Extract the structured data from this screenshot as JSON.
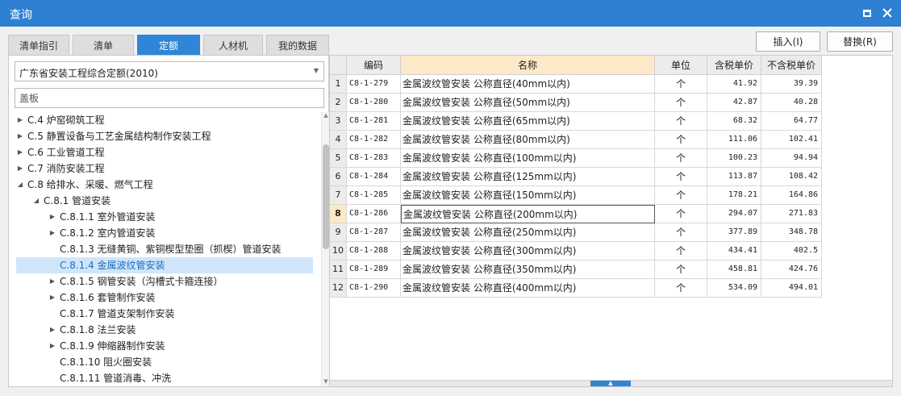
{
  "window": {
    "title": "查询"
  },
  "tabs": [
    "清单指引",
    "清单",
    "定额",
    "人材机",
    "我的数据"
  ],
  "active_tab": "定额",
  "left": {
    "dropdown_value": "广东省安装工程综合定额(2010)",
    "search_value": "盖板",
    "tree": [
      {
        "label": "C.4 炉窑砌筑工程",
        "toggle": "▶"
      },
      {
        "label": "C.5 静置设备与工艺金属结构制作安装工程",
        "toggle": "▶"
      },
      {
        "label": "C.6 工业管道工程",
        "toggle": "▶"
      },
      {
        "label": "C.7 消防安装工程",
        "toggle": "▶"
      },
      {
        "label": "C.8 给排水、采暖、燃气工程",
        "toggle": "◢"
      },
      {
        "label": "C.8.1 管道安装",
        "toggle": "◢"
      },
      {
        "label": "C.8.1.1 室外管道安装",
        "toggle": "▶"
      },
      {
        "label": "C.8.1.2 室内管道安装",
        "toggle": "▶"
      },
      {
        "label": "C.8.1.3 无缝黄铜、紫铜楔型垫圈（抓楔）管道安装",
        "toggle": ""
      },
      {
        "label": "C.8.1.4 金属波纹管安装",
        "toggle": ""
      },
      {
        "label": "C.8.1.5 钢管安装（沟槽式卡箍连接）",
        "toggle": "▶"
      },
      {
        "label": "C.8.1.6 套管制作安装",
        "toggle": "▶"
      },
      {
        "label": "C.8.1.7 管道支架制作安装",
        "toggle": ""
      },
      {
        "label": "C.8.1.8 法兰安装",
        "toggle": "▶"
      },
      {
        "label": "C.8.1.9 伸缩器制作安装",
        "toggle": "▶"
      },
      {
        "label": "C.8.1.10 阻火圈安装",
        "toggle": ""
      },
      {
        "label": "C.8.1.11 管道消毒、冲洗",
        "toggle": ""
      }
    ],
    "selected_item": "C.8.1.4 金属波纹管安装"
  },
  "toolbar": {
    "insert_label": "插入(I)",
    "replace_label": "替换(R)"
  },
  "table": {
    "headers": [
      "编码",
      "名称",
      "单位",
      "含税单价",
      "不含税单价"
    ],
    "current_row": "8",
    "rows": [
      [
        "1",
        "C8-1-279",
        "金属波纹管安装 公称直径(40mm以内)",
        "个",
        "41.92",
        "39.39"
      ],
      [
        "2",
        "C8-1-280",
        "金属波纹管安装 公称直径(50mm以内)",
        "个",
        "42.87",
        "40.28"
      ],
      [
        "3",
        "C8-1-281",
        "金属波纹管安装 公称直径(65mm以内)",
        "个",
        "68.32",
        "64.77"
      ],
      [
        "4",
        "C8-1-282",
        "金属波纹管安装 公称直径(80mm以内)",
        "个",
        "111.06",
        "102.41"
      ],
      [
        "5",
        "C8-1-283",
        "金属波纹管安装 公称直径(100mm以内)",
        "个",
        "100.23",
        "94.94"
      ],
      [
        "6",
        "C8-1-284",
        "金属波纹管安装 公称直径(125mm以内)",
        "个",
        "113.87",
        "108.42"
      ],
      [
        "7",
        "C8-1-285",
        "金属波纹管安装 公称直径(150mm以内)",
        "个",
        "178.21",
        "164.86"
      ],
      [
        "8",
        "C8-1-286",
        "金属波纹管安装 公称直径(200mm以内)",
        "个",
        "294.07",
        "271.83"
      ],
      [
        "9",
        "C8-1-287",
        "金属波纹管安装 公称直径(250mm以内)",
        "个",
        "377.89",
        "348.78"
      ],
      [
        "10",
        "C8-1-288",
        "金属波纹管安装 公称直径(300mm以内)",
        "个",
        "434.41",
        "402.5"
      ],
      [
        "11",
        "C8-1-289",
        "金属波纹管安装 公称直径(350mm以内)",
        "个",
        "458.81",
        "424.76"
      ],
      [
        "12",
        "C8-1-290",
        "金属波纹管安装 公称直径(400mm以内)",
        "个",
        "534.09",
        "494.01"
      ]
    ]
  },
  "icons": {
    "maximize": "maximize-icon",
    "close": "close-icon",
    "dropdown": "chevron-down-icon",
    "scroll_up": "scroll-up-icon",
    "scroll_down": "scroll-down-icon",
    "grip": "splitter-grip-icon"
  },
  "colors": {
    "titlebar": "#2f7fd3",
    "active_tab": "#2f86d8",
    "selected_row": "#cfe6fa",
    "header_highlight": "#fde9c8"
  }
}
